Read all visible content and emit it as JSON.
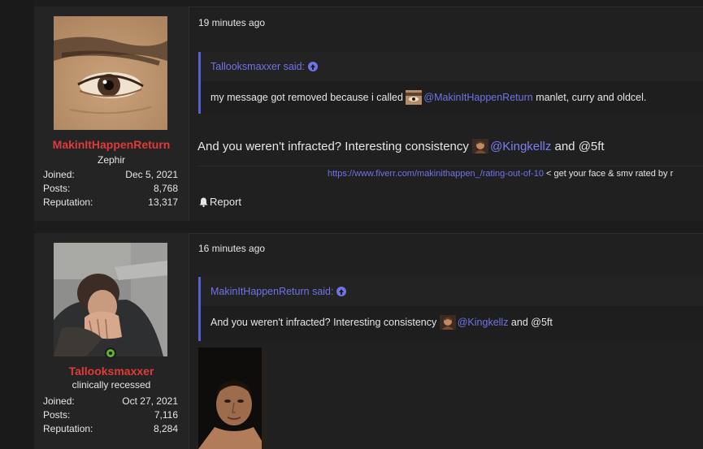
{
  "posts": [
    {
      "user": {
        "name": "MakinItHappenReturn",
        "title": "Zephir",
        "stats": [
          {
            "label": "Joined:",
            "value": "Dec 5, 2021"
          },
          {
            "label": "Posts:",
            "value": "8,768"
          },
          {
            "label": "Reputation:",
            "value": "13,317"
          }
        ]
      },
      "timestamp": "19 minutes ago",
      "quote": {
        "author": "Tallooksmaxxer said:",
        "text_before": "my message got removed because i called",
        "mention": "@MakinItHappenReturn",
        "text_after": " manlet, curry and oldcel."
      },
      "body": {
        "text_before": "And you weren't infracted? Interesting consistency ",
        "mention": "@Kingkellz",
        "text_after": " and @5ft"
      },
      "signature": {
        "link": "https://www.fiverr.com/makinithappen_/rating-out-of-10",
        "text": " < get your face & smv rated by r"
      },
      "report_label": "Report"
    },
    {
      "user": {
        "name": "Tallooksmaxxer",
        "title": "clinically recessed",
        "online": true,
        "stats": [
          {
            "label": "Joined:",
            "value": "Oct 27, 2021"
          },
          {
            "label": "Posts:",
            "value": "7,116"
          },
          {
            "label": "Reputation:",
            "value": "8,284"
          }
        ]
      },
      "timestamp": "16 minutes ago",
      "quote": {
        "author": "MakinItHappenReturn said:",
        "text_before": "And you weren't infracted? Interesting consistency",
        "mention": "@Kingkellz",
        "text_after": " and @5ft"
      }
    }
  ],
  "colors": {
    "username": "#e03a3a",
    "link": "#6f73e8",
    "online": "#63b132"
  }
}
